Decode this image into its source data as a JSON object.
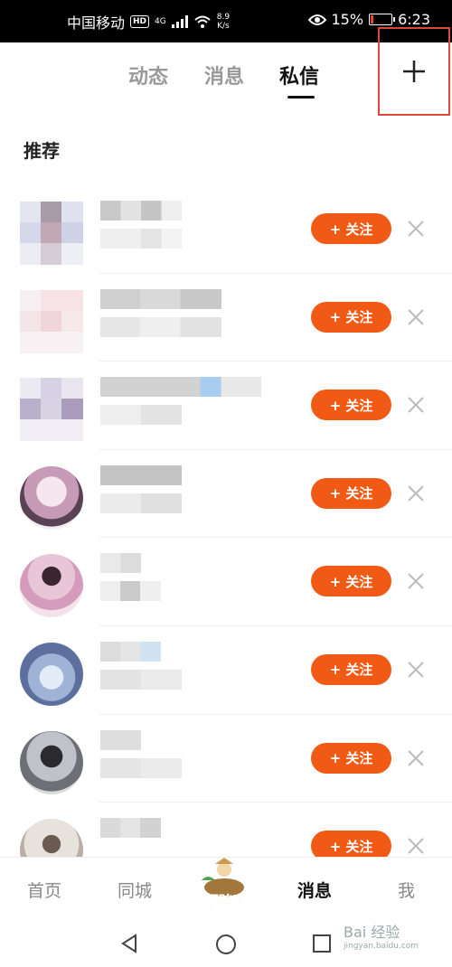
{
  "status_bar": {
    "carrier": "中国移动",
    "hd": "HD",
    "network": "4G",
    "speed_value": "8.9",
    "speed_unit": "K/s",
    "battery": "15%",
    "time": "6:23",
    "battery_level": 0.15
  },
  "tabs": [
    {
      "label": "动态",
      "active": false
    },
    {
      "label": "消息",
      "active": false
    },
    {
      "label": "私信",
      "active": true
    }
  ],
  "header": {
    "plus_icon": "plus-icon"
  },
  "section": {
    "title": "推荐"
  },
  "recommend": {
    "follow_label": "+ 关注",
    "close_icon": "close-icon",
    "count": 8
  },
  "bottom_nav": [
    {
      "label": "首页",
      "active": false
    },
    {
      "label": "同城",
      "active": false
    },
    {
      "label": "清明踏青",
      "active": false
    },
    {
      "label": "消息",
      "active": true
    },
    {
      "label": "我",
      "active": false
    }
  ],
  "watermark": {
    "text": "Bai 经验",
    "sub": "jingyan.baidu.com"
  },
  "colors": {
    "accent": "#f05a14",
    "highlight_box": "#e0453a"
  }
}
